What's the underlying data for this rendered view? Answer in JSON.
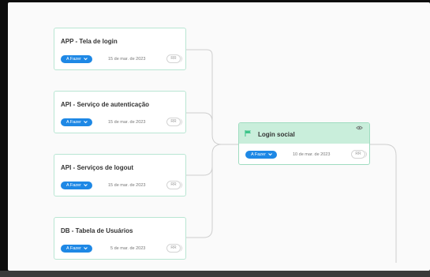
{
  "cards": [
    {
      "title": "APP - Tela de login",
      "status": "A Fazer",
      "date": "15 de mar. de 2023",
      "assignee": "RR"
    },
    {
      "title": "API - Serviço de autenticação",
      "status": "A Fazer",
      "date": "15 de mar. de 2023",
      "assignee": "RR"
    },
    {
      "title": "API - Serviços de logout",
      "status": "A Fazer",
      "date": "15 de mar. de 2023",
      "assignee": "RR"
    },
    {
      "title": "DB - Tabela de Usuários",
      "status": "A Fazer",
      "date": "5 de mar. de 2023",
      "assignee": "RR"
    }
  ],
  "parent": {
    "title": "Login social",
    "status": "A Fazer",
    "date": "10 de mar. de 2023",
    "assignee": "RR"
  },
  "colors": {
    "status_pill": "#1e88e5",
    "parent_header": "#c9eedb",
    "card_border": "#b9e6d3"
  },
  "icons": {
    "parent_flag": "flag-icon",
    "parent_watch": "eye-icon",
    "status_dropdown": "chevron-down-icon"
  }
}
